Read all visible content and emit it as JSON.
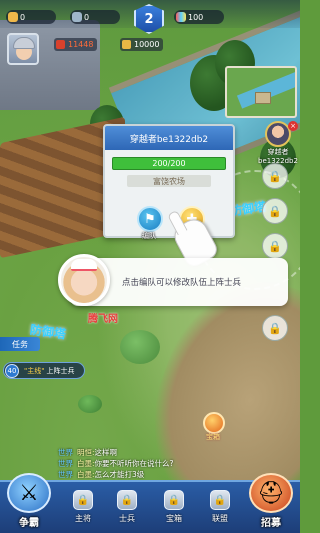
{
  "top_bar": {
    "food": "0",
    "stone": "0",
    "level": "2",
    "tokens": "100"
  },
  "player": {
    "power": "11448",
    "gold": "10000"
  },
  "map_player": {
    "line1": "穿越者",
    "line2": "be1322db2"
  },
  "farm_popup": {
    "owner": "穿越者be1322db2",
    "hp": "200/200",
    "type": "富饶农场",
    "edit_label": "编队",
    "supply_label": "补兵"
  },
  "defense_tower_label": "防御塔",
  "tutorial_text": "点击编队可以修改队伍上阵士兵",
  "watermark": "腾飞网",
  "task_panel": {
    "tab_label": "任务",
    "task_number": "40",
    "task_highlight": "\"主线\"",
    "task_text": "上阵士兵"
  },
  "gift_label": "宝箱",
  "chat": [
    {
      "channel": "世界",
      "speaker": "明恒:",
      "text": "这样啊"
    },
    {
      "channel": "世界",
      "speaker": "白墨:",
      "text": "你要不听听你在说什么?"
    },
    {
      "channel": "世界",
      "speaker": "白墨:",
      "text": "怎么才能打3级"
    }
  ],
  "bottom_nav": {
    "compete": "争霸",
    "general": "主将",
    "soldier": "士兵",
    "treasury": "宝箱",
    "alliance": "联盟",
    "recruit": "招募"
  },
  "colors": {
    "primary_blue": "#2e67b6",
    "hp_green": "#3fbf3b",
    "power_red": "#ff6b3a",
    "tower_cyan": "#3ad2ff"
  }
}
